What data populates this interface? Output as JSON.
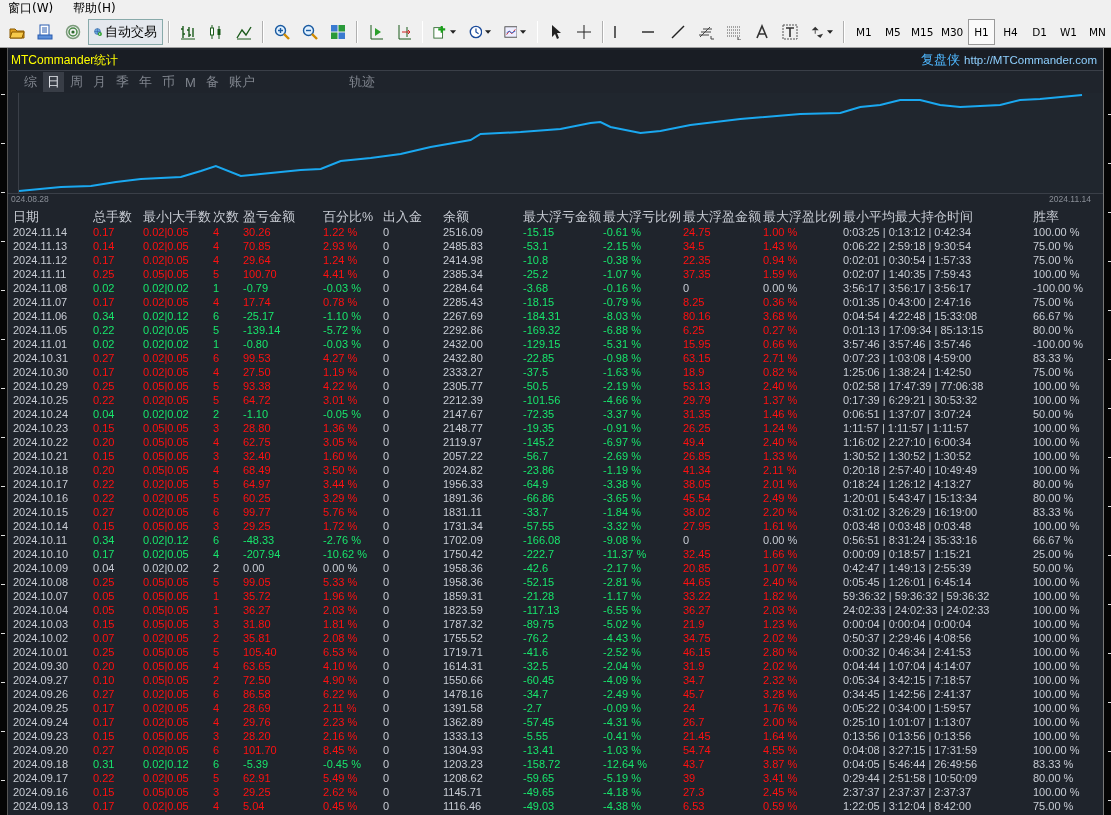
{
  "menu": [
    "窗口(W)",
    "帮助(H)"
  ],
  "toolbar": {
    "auto_trade": "自动交易",
    "timeframes": [
      {
        "label": "M1",
        "selected": false
      },
      {
        "label": "M5",
        "selected": false
      },
      {
        "label": "M15",
        "selected": false
      },
      {
        "label": "M30",
        "selected": false
      },
      {
        "label": "H1",
        "selected": true
      },
      {
        "label": "H4",
        "selected": false
      },
      {
        "label": "D1",
        "selected": false
      },
      {
        "label": "W1",
        "selected": false
      },
      {
        "label": "MN",
        "selected": false
      }
    ]
  },
  "panel": {
    "title": "MTCommander统计",
    "brand": "复盘侠",
    "url": "http://MTCommander.com",
    "tabs": [
      {
        "label": "综",
        "selected": false
      },
      {
        "label": "日",
        "selected": true
      },
      {
        "label": "周",
        "selected": false
      },
      {
        "label": "月",
        "selected": false
      },
      {
        "label": "季",
        "selected": false
      },
      {
        "label": "年",
        "selected": false
      },
      {
        "label": "币",
        "selected": false
      },
      {
        "label": "M",
        "selected": false
      },
      {
        "label": "备",
        "selected": false
      },
      {
        "label": "账户",
        "selected": false
      }
    ],
    "track_tab": {
      "label": "轨迹",
      "selected": false
    },
    "chart": {
      "start_label": "024.08.28",
      "end_label": "2024.11.14"
    },
    "table": {
      "columns": [
        "日期",
        "总手数",
        "最小|大手数",
        "次数",
        "盈亏金额",
        "百分比%",
        "出入金",
        "余额",
        "最大浮亏金额",
        "最大浮亏比例",
        "最大浮盈金额",
        "最大浮盈比例",
        "最小平均最大持仓时间",
        "胜率"
      ],
      "rows": [
        {
          "kind": "gain",
          "float_gain": true,
          "cells": [
            "2024.11.14",
            "0.17",
            "0.02|0.05",
            "4",
            "30.26",
            "1.22 %",
            "0",
            "2516.09",
            "-15.15",
            "-0.61 %",
            "24.75",
            "1.00 %",
            "0:03:25 | 0:13:12 | 0:42:34",
            "100.00 %"
          ]
        },
        {
          "kind": "gain",
          "float_gain": true,
          "cells": [
            "2024.11.13",
            "0.14",
            "0.02|0.05",
            "4",
            "70.85",
            "2.93 %",
            "0",
            "2485.83",
            "-53.1",
            "-2.15 %",
            "34.5",
            "1.43 %",
            "0:06:22 | 2:59:18 | 9:30:54",
            "75.00 %"
          ]
        },
        {
          "kind": "gain",
          "float_gain": true,
          "cells": [
            "2024.11.12",
            "0.17",
            "0.02|0.05",
            "4",
            "29.64",
            "1.24 %",
            "0",
            "2414.98",
            "-10.8",
            "-0.38 %",
            "22.35",
            "0.94 %",
            "0:02:01 | 0:30:54 | 1:57:33",
            "75.00 %"
          ]
        },
        {
          "kind": "gain",
          "float_gain": true,
          "cells": [
            "2024.11.11",
            "0.25",
            "0.05|0.05",
            "5",
            "100.70",
            "4.41 %",
            "0",
            "2385.34",
            "-25.2",
            "-1.07 %",
            "37.35",
            "1.59 %",
            "0:02:07 | 1:40:35 | 7:59:43",
            "100.00 %"
          ]
        },
        {
          "kind": "loss",
          "float_gain": false,
          "cells": [
            "2024.11.08",
            "0.02",
            "0.02|0.02",
            "1",
            "-0.79",
            "-0.03 %",
            "0",
            "2284.64",
            "-3.68",
            "-0.16 %",
            "0",
            "0.00 %",
            "3:56:17 | 3:56:17 | 3:56:17",
            "-100.00 %"
          ]
        },
        {
          "kind": "gain",
          "float_gain": true,
          "cells": [
            "2024.11.07",
            "0.17",
            "0.02|0.05",
            "4",
            "17.74",
            "0.78 %",
            "0",
            "2285.43",
            "-18.15",
            "-0.79 %",
            "8.25",
            "0.36 %",
            "0:01:35 | 0:43:00 | 2:47:16",
            "75.00 %"
          ]
        },
        {
          "kind": "loss",
          "float_gain": true,
          "cells": [
            "2024.11.06",
            "0.34",
            "0.02|0.12",
            "6",
            "-25.17",
            "-1.10 %",
            "0",
            "2267.69",
            "-184.31",
            "-8.03 %",
            "80.16",
            "3.68 %",
            "0:04:54 | 4:22:48 | 15:33:08",
            "66.67 %"
          ]
        },
        {
          "kind": "loss",
          "float_gain": true,
          "cells": [
            "2024.11.05",
            "0.22",
            "0.02|0.05",
            "5",
            "-139.14",
            "-5.72 %",
            "0",
            "2292.86",
            "-169.32",
            "-6.88 %",
            "6.25",
            "0.27 %",
            "0:01:13 | 17:09:34 | 85:13:15",
            "80.00 %"
          ]
        },
        {
          "kind": "loss",
          "float_gain": true,
          "cells": [
            "2024.11.01",
            "0.02",
            "0.02|0.02",
            "1",
            "-0.80",
            "-0.03 %",
            "0",
            "2432.00",
            "-129.15",
            "-5.31 %",
            "15.95",
            "0.66 %",
            "3:57:46 | 3:57:46 | 3:57:46",
            "-100.00 %"
          ]
        },
        {
          "kind": "gain",
          "float_gain": true,
          "cells": [
            "2024.10.31",
            "0.27",
            "0.02|0.05",
            "6",
            "99.53",
            "4.27 %",
            "0",
            "2432.80",
            "-22.85",
            "-0.98 %",
            "63.15",
            "2.71 %",
            "0:07:23 | 1:03:08 | 4:59:00",
            "83.33 %"
          ]
        },
        {
          "kind": "gain",
          "float_gain": true,
          "cells": [
            "2024.10.30",
            "0.17",
            "0.02|0.05",
            "4",
            "27.50",
            "1.19 %",
            "0",
            "2333.27",
            "-37.5",
            "-1.63 %",
            "18.9",
            "0.82 %",
            "1:25:06 | 1:38:24 | 1:42:50",
            "75.00 %"
          ]
        },
        {
          "kind": "gain",
          "float_gain": true,
          "cells": [
            "2024.10.29",
            "0.25",
            "0.05|0.05",
            "5",
            "93.38",
            "4.22 %",
            "0",
            "2305.77",
            "-50.5",
            "-2.19 %",
            "53.13",
            "2.40 %",
            "0:02:58 | 17:47:39 | 77:06:38",
            "100.00 %"
          ]
        },
        {
          "kind": "gain",
          "float_gain": true,
          "cells": [
            "2024.10.25",
            "0.22",
            "0.02|0.05",
            "5",
            "64.72",
            "3.01 %",
            "0",
            "2212.39",
            "-101.56",
            "-4.66 %",
            "29.79",
            "1.37 %",
            "0:17:39 | 6:29:21 | 30:53:32",
            "100.00 %"
          ]
        },
        {
          "kind": "loss",
          "float_gain": true,
          "cells": [
            "2024.10.24",
            "0.04",
            "0.02|0.02",
            "2",
            "-1.10",
            "-0.05 %",
            "0",
            "2147.67",
            "-72.35",
            "-3.37 %",
            "31.35",
            "1.46 %",
            "0:06:51 | 1:37:07 | 3:07:24",
            "50.00 %"
          ]
        },
        {
          "kind": "gain",
          "float_gain": true,
          "cells": [
            "2024.10.23",
            "0.15",
            "0.05|0.05",
            "3",
            "28.80",
            "1.36 %",
            "0",
            "2148.77",
            "-19.35",
            "-0.91 %",
            "26.25",
            "1.24 %",
            "1:11:57 | 1:11:57 | 1:11:57",
            "100.00 %"
          ]
        },
        {
          "kind": "gain",
          "float_gain": true,
          "cells": [
            "2024.10.22",
            "0.20",
            "0.05|0.05",
            "4",
            "62.75",
            "3.05 %",
            "0",
            "2119.97",
            "-145.2",
            "-6.97 %",
            "49.4",
            "2.40 %",
            "1:16:02 | 2:27:10 | 6:00:34",
            "100.00 %"
          ]
        },
        {
          "kind": "gain",
          "float_gain": true,
          "cells": [
            "2024.10.21",
            "0.15",
            "0.05|0.05",
            "3",
            "32.40",
            "1.60 %",
            "0",
            "2057.22",
            "-56.7",
            "-2.69 %",
            "26.85",
            "1.33 %",
            "1:30:52 | 1:30:52 | 1:30:52",
            "100.00 %"
          ]
        },
        {
          "kind": "gain",
          "float_gain": true,
          "cells": [
            "2024.10.18",
            "0.20",
            "0.05|0.05",
            "4",
            "68.49",
            "3.50 %",
            "0",
            "2024.82",
            "-23.86",
            "-1.19 %",
            "41.34",
            "2.11 %",
            "0:20:18 | 2:57:40 | 10:49:49",
            "100.00 %"
          ]
        },
        {
          "kind": "gain",
          "float_gain": true,
          "cells": [
            "2024.10.17",
            "0.22",
            "0.02|0.05",
            "5",
            "64.97",
            "3.44 %",
            "0",
            "1956.33",
            "-64.9",
            "-3.38 %",
            "38.05",
            "2.01 %",
            "0:18:24 | 1:26:12 | 4:13:27",
            "80.00 %"
          ]
        },
        {
          "kind": "gain",
          "float_gain": true,
          "cells": [
            "2024.10.16",
            "0.22",
            "0.02|0.05",
            "5",
            "60.25",
            "3.29 %",
            "0",
            "1891.36",
            "-66.86",
            "-3.65 %",
            "45.54",
            "2.49 %",
            "1:20:01 | 5:43:47 | 15:13:34",
            "80.00 %"
          ]
        },
        {
          "kind": "gain",
          "float_gain": true,
          "cells": [
            "2024.10.15",
            "0.27",
            "0.02|0.05",
            "6",
            "99.77",
            "5.76 %",
            "0",
            "1831.11",
            "-33.7",
            "-1.84 %",
            "38.02",
            "2.20 %",
            "0:31:02 | 3:26:29 | 16:19:00",
            "83.33 %"
          ]
        },
        {
          "kind": "gain",
          "float_gain": true,
          "cells": [
            "2024.10.14",
            "0.15",
            "0.05|0.05",
            "3",
            "29.25",
            "1.72 %",
            "0",
            "1731.34",
            "-57.55",
            "-3.32 %",
            "27.95",
            "1.61 %",
            "0:03:48 | 0:03:48 | 0:03:48",
            "100.00 %"
          ]
        },
        {
          "kind": "loss",
          "float_gain": false,
          "cells": [
            "2024.10.11",
            "0.34",
            "0.02|0.12",
            "6",
            "-48.33",
            "-2.76 %",
            "0",
            "1702.09",
            "-166.08",
            "-9.08 %",
            "0",
            "0.00 %",
            "0:56:51 | 8:31:24 | 35:33:16",
            "66.67 %"
          ]
        },
        {
          "kind": "loss",
          "float_gain": true,
          "cells": [
            "2024.10.10",
            "0.17",
            "0.02|0.05",
            "4",
            "-207.94",
            "-10.62 %",
            "0",
            "1750.42",
            "-222.7",
            "-11.37 %",
            "32.45",
            "1.66 %",
            "0:00:09 | 0:18:57 | 1:15:21",
            "25.00 %"
          ]
        },
        {
          "kind": "flat",
          "float_gain": true,
          "cells": [
            "2024.10.09",
            "0.04",
            "0.02|0.02",
            "2",
            "0.00",
            "0.00 %",
            "0",
            "1958.36",
            "-42.6",
            "-2.17 %",
            "20.85",
            "1.07 %",
            "0:42:47 | 1:49:13 | 2:55:39",
            "50.00 %"
          ]
        },
        {
          "kind": "gain",
          "float_gain": true,
          "cells": [
            "2024.10.08",
            "0.25",
            "0.05|0.05",
            "5",
            "99.05",
            "5.33 %",
            "0",
            "1958.36",
            "-52.15",
            "-2.81 %",
            "44.65",
            "2.40 %",
            "0:05:45 | 1:26:01 | 6:45:14",
            "100.00 %"
          ]
        },
        {
          "kind": "gain",
          "float_gain": true,
          "cells": [
            "2024.10.07",
            "0.05",
            "0.05|0.05",
            "1",
            "35.72",
            "1.96 %",
            "0",
            "1859.31",
            "-21.28",
            "-1.17 %",
            "33.22",
            "1.82 %",
            "59:36:32 | 59:36:32 | 59:36:32",
            "100.00 %"
          ]
        },
        {
          "kind": "gain",
          "float_gain": true,
          "cells": [
            "2024.10.04",
            "0.05",
            "0.05|0.05",
            "1",
            "36.27",
            "2.03 %",
            "0",
            "1823.59",
            "-117.13",
            "-6.55 %",
            "36.27",
            "2.03 %",
            "24:02:33 | 24:02:33 | 24:02:33",
            "100.00 %"
          ]
        },
        {
          "kind": "gain",
          "float_gain": true,
          "cells": [
            "2024.10.03",
            "0.15",
            "0.05|0.05",
            "3",
            "31.80",
            "1.81 %",
            "0",
            "1787.32",
            "-89.75",
            "-5.02 %",
            "21.9",
            "1.23 %",
            "0:00:04 | 0:00:04 | 0:00:04",
            "100.00 %"
          ]
        },
        {
          "kind": "gain",
          "float_gain": true,
          "cells": [
            "2024.10.02",
            "0.07",
            "0.02|0.05",
            "2",
            "35.81",
            "2.08 %",
            "0",
            "1755.52",
            "-76.2",
            "-4.43 %",
            "34.75",
            "2.02 %",
            "0:50:37 | 2:29:46 | 4:08:56",
            "100.00 %"
          ]
        },
        {
          "kind": "gain",
          "float_gain": true,
          "cells": [
            "2024.10.01",
            "0.25",
            "0.05|0.05",
            "5",
            "105.40",
            "6.53 %",
            "0",
            "1719.71",
            "-41.6",
            "-2.52 %",
            "46.15",
            "2.80 %",
            "0:00:32 | 0:46:34 | 2:41:53",
            "100.00 %"
          ]
        },
        {
          "kind": "gain",
          "float_gain": true,
          "cells": [
            "2024.09.30",
            "0.20",
            "0.05|0.05",
            "4",
            "63.65",
            "4.10 %",
            "0",
            "1614.31",
            "-32.5",
            "-2.04 %",
            "31.9",
            "2.02 %",
            "0:04:44 | 1:07:04 | 4:14:07",
            "100.00 %"
          ]
        },
        {
          "kind": "gain",
          "float_gain": true,
          "cells": [
            "2024.09.27",
            "0.10",
            "0.05|0.05",
            "2",
            "72.50",
            "4.90 %",
            "0",
            "1550.66",
            "-60.45",
            "-4.09 %",
            "34.7",
            "2.32 %",
            "0:05:34 | 3:42:15 | 7:18:57",
            "100.00 %"
          ]
        },
        {
          "kind": "gain",
          "float_gain": true,
          "cells": [
            "2024.09.26",
            "0.27",
            "0.02|0.05",
            "6",
            "86.58",
            "6.22 %",
            "0",
            "1478.16",
            "-34.7",
            "-2.49 %",
            "45.7",
            "3.28 %",
            "0:34:45 | 1:42:56 | 2:41:37",
            "100.00 %"
          ]
        },
        {
          "kind": "gain",
          "float_gain": true,
          "cells": [
            "2024.09.25",
            "0.17",
            "0.02|0.05",
            "4",
            "28.69",
            "2.11 %",
            "0",
            "1391.58",
            "-2.7",
            "-0.09 %",
            "24",
            "1.76 %",
            "0:05:22 | 0:34:00 | 1:59:57",
            "100.00 %"
          ]
        },
        {
          "kind": "gain",
          "float_gain": true,
          "cells": [
            "2024.09.24",
            "0.17",
            "0.02|0.05",
            "4",
            "29.76",
            "2.23 %",
            "0",
            "1362.89",
            "-57.45",
            "-4.31 %",
            "26.7",
            "2.00 %",
            "0:25:10 | 1:01:07 | 1:13:07",
            "100.00 %"
          ]
        },
        {
          "kind": "gain",
          "float_gain": true,
          "cells": [
            "2024.09.23",
            "0.15",
            "0.05|0.05",
            "3",
            "28.20",
            "2.16 %",
            "0",
            "1333.13",
            "-5.55",
            "-0.41 %",
            "21.45",
            "1.64 %",
            "0:13:56 | 0:13:56 | 0:13:56",
            "100.00 %"
          ]
        },
        {
          "kind": "gain",
          "float_gain": true,
          "cells": [
            "2024.09.20",
            "0.27",
            "0.02|0.05",
            "6",
            "101.70",
            "8.45 %",
            "0",
            "1304.93",
            "-13.41",
            "-1.03 %",
            "54.74",
            "4.55 %",
            "0:04:08 | 3:27:15 | 17:31:59",
            "100.00 %"
          ]
        },
        {
          "kind": "loss",
          "float_gain": true,
          "cells": [
            "2024.09.18",
            "0.31",
            "0.02|0.12",
            "6",
            "-5.39",
            "-0.45 %",
            "0",
            "1203.23",
            "-158.72",
            "-12.64 %",
            "43.7",
            "3.87 %",
            "0:04:05 | 5:46:44 | 26:49:56",
            "83.33 %"
          ]
        },
        {
          "kind": "gain",
          "float_gain": true,
          "cells": [
            "2024.09.17",
            "0.22",
            "0.02|0.05",
            "5",
            "62.91",
            "5.49 %",
            "0",
            "1208.62",
            "-59.65",
            "-5.19 %",
            "39",
            "3.41 %",
            "0:29:44 | 2:51:58 | 10:50:09",
            "80.00 %"
          ]
        },
        {
          "kind": "gain",
          "float_gain": true,
          "cells": [
            "2024.09.16",
            "0.15",
            "0.05|0.05",
            "3",
            "29.25",
            "2.62 %",
            "0",
            "1145.71",
            "-49.65",
            "-4.18 %",
            "27.3",
            "2.45 %",
            "2:37:37 | 2:37:37 | 2:37:37",
            "100.00 %"
          ]
        },
        {
          "kind": "gain",
          "float_gain": true,
          "cells": [
            "2024.09.13",
            "0.17",
            "0.02|0.05",
            "4",
            "5.04",
            "0.45 %",
            "0",
            "1116.46",
            "-49.03",
            "-4.38 %",
            "6.53",
            "0.59 %",
            "1:22:05 | 3:12:04 | 8:42:00",
            "75.00 %"
          ]
        }
      ]
    }
  }
}
